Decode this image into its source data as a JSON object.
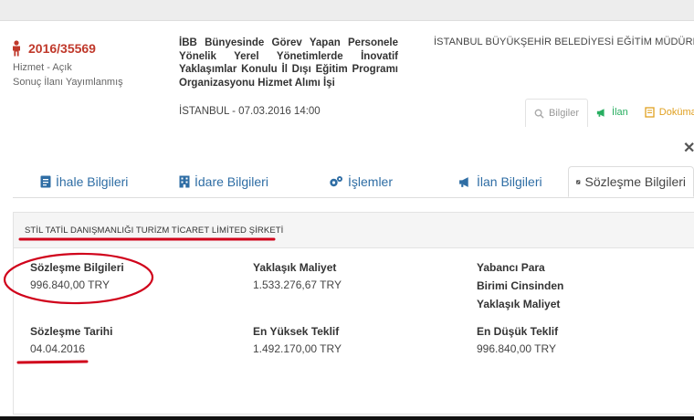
{
  "header": {
    "tender_number": "2016/35569",
    "status_lines": [
      "Hizmet - Açık",
      "Sonuç İlanı Yayımlanmış"
    ],
    "title": "İBB Bünyesinde Görev Yapan Personele Yönelik Yerel Yönetimlerde İnovatif Yaklaşımlar Konulu İl Dışı Eğitim Programı Organizasyonu Hizmet Alımı İşi",
    "institution": "İSTANBUL BÜYÜKŞEHİR BELEDİYESİ EĞİTİM MÜDÜRLÜĞÜ",
    "location_date": "İSTANBUL - 07.03.2016 14:00"
  },
  "mini_tabs": [
    {
      "label": "Bilgiler",
      "icon": "search-icon"
    },
    {
      "label": "İlan",
      "icon": "megaphone-icon"
    },
    {
      "label": "Dokümanlar",
      "icon": "document-icon"
    }
  ],
  "tabs": [
    {
      "label": "İhale Bilgileri",
      "icon": "document-icon"
    },
    {
      "label": "İdare Bilgileri",
      "icon": "building-icon"
    },
    {
      "label": "İşlemler",
      "icon": "gears-icon"
    },
    {
      "label": "İlan Bilgileri",
      "icon": "megaphone-icon"
    },
    {
      "label": "Sözleşme Bilgileri",
      "icon": "edit-icon"
    }
  ],
  "contract": {
    "company": "STİL TATİL DANIŞMANLIĞI TURİZM TİCARET LİMİTED ŞİRKETİ",
    "fields": [
      {
        "label": "Sözleşme Bilgileri",
        "value": "996.840,00 TRY"
      },
      {
        "label": "Yaklaşık Maliyet",
        "value": "1.533.276,67 TRY"
      },
      {
        "label": "Yabancı Para Birimi Cinsinden Yaklaşık Maliyet",
        "value": ""
      },
      {
        "label": "Sözleşme Tarihi",
        "value": "04.04.2016"
      },
      {
        "label": "En Yüksek Teklif",
        "value": "1.492.170,00 TRY"
      },
      {
        "label": "En Düşük Teklif",
        "value": "996.840,00 TRY"
      }
    ]
  },
  "colors": {
    "accent": "#2e6da4",
    "tender_number": "#c0392b",
    "annotation": "#d0021b",
    "ilan_green": "#27ae60",
    "docs_orange": "#e0a020"
  }
}
